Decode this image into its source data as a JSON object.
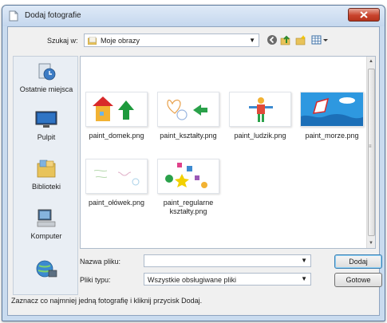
{
  "window": {
    "title": "Dodaj fotografie"
  },
  "lookin": {
    "label": "Szukaj w:",
    "value": "Moje obrazy"
  },
  "toolbar": {
    "icons": [
      "back-icon",
      "up-folder-icon",
      "new-folder-icon",
      "view-menu-icon"
    ]
  },
  "places": [
    {
      "label": "Ostatnie miejsca",
      "icon": "recent-places-icon"
    },
    {
      "label": "Pulpit",
      "icon": "desktop-icon"
    },
    {
      "label": "Biblioteki",
      "icon": "libraries-icon"
    },
    {
      "label": "Komputer",
      "icon": "computer-icon"
    },
    {
      "label": "",
      "icon": "network-icon"
    }
  ],
  "files": [
    {
      "name": "paint_domek.png"
    },
    {
      "name": "paint_kształty.png"
    },
    {
      "name": "paint_ludzik.png"
    },
    {
      "name": "paint_morze.png"
    },
    {
      "name": "paint_ołówek.png"
    },
    {
      "name": "paint_regularne kształty.png"
    }
  ],
  "filename": {
    "label": "Nazwa pliku:",
    "value": ""
  },
  "filetype": {
    "label": "Pliki typu:",
    "value": "Wszystkie obsługiwane pliki"
  },
  "buttons": {
    "open": "Dodaj",
    "cancel": "Gotowe"
  },
  "status": {
    "text": "Zaznacz co najmniej jedną fotografię i kliknij przycisk Dodaj."
  },
  "colors": {
    "accent": "#3c7fb1",
    "close": "#c9432c",
    "selection": "#cce8ff"
  }
}
